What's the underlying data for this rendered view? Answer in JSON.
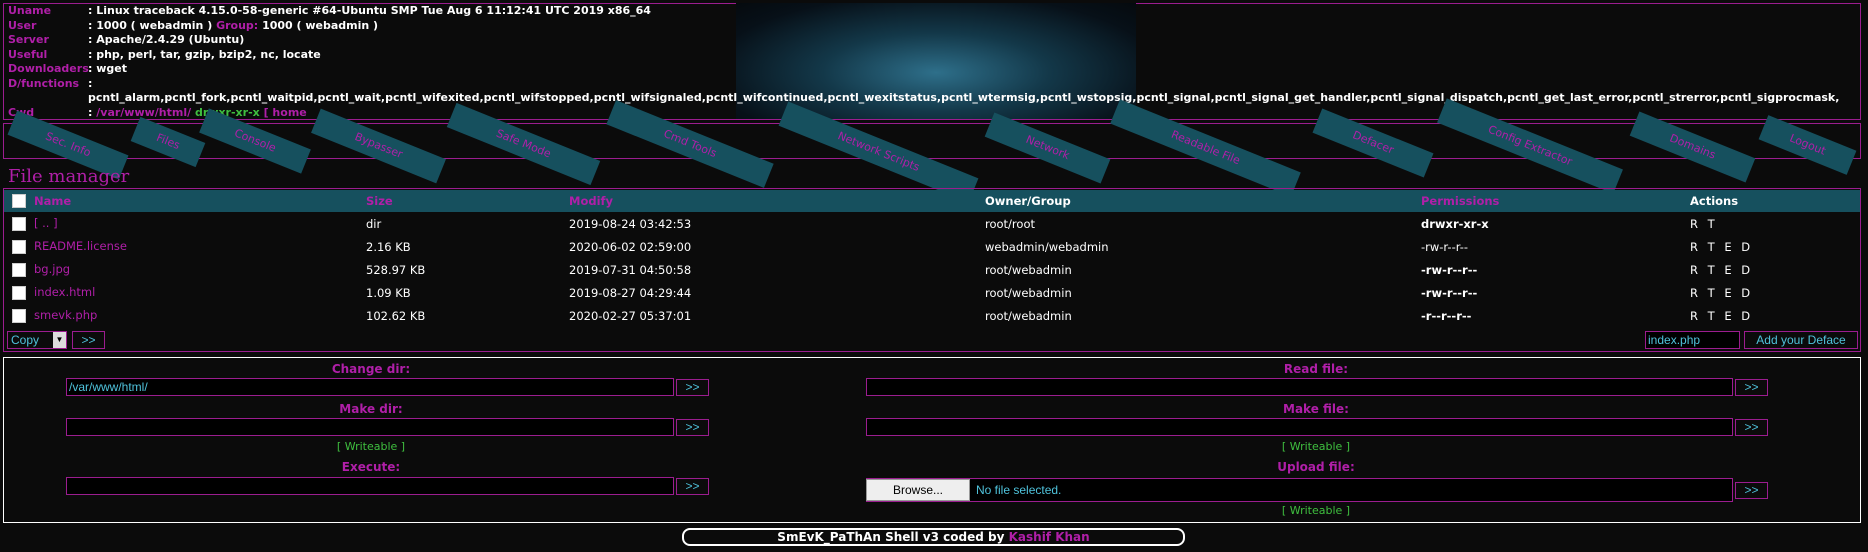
{
  "info": {
    "uname_label": "Uname",
    "uname_value": ": Linux traceback 4.15.0-58-generic #64-Ubuntu SMP Tue Aug 6 11:12:41 UTC 2019 x86_64",
    "user_label": "User",
    "user_value": ": 1000 ( webadmin )",
    "group_label": "Group:",
    "group_value": "1000 ( webadmin )",
    "server_label": "Server",
    "server_value": ": Apache/2.4.29 (Ubuntu)",
    "useful_label": "Useful",
    "useful_value": ": php, perl, tar, gzip, bzip2, nc, locate",
    "downloaders_label": "Downloaders",
    "downloaders_value": ": wget",
    "dfunctions_label": "D/functions",
    "dfunctions_value": ":",
    "functions_list": "pcntl_alarm,pcntl_fork,pcntl_waitpid,pcntl_wait,pcntl_wifexited,pcntl_wifstopped,pcntl_wifsignaled,pcntl_wifcontinued,pcntl_wexitstatus,pcntl_wtermsig,pcntl_wstopsig,pcntl_signal,pcntl_signal_get_handler,pcntl_signal_dispatch,pcntl_get_last_error,pcntl_strerror,pcntl_sigprocmask,",
    "cwd_label": "Cwd",
    "cwd_colon": ":",
    "cwd_path": "/var/www/html/",
    "cwd_perm": "drwxr-xr-x",
    "cwd_home": "[ home"
  },
  "menu": {
    "tabs": [
      "Sec. Info",
      "Files",
      "Console",
      "Bypasser",
      "Safe Mode",
      "Cmd Tools",
      "Network Scripts",
      "Network",
      "Readable File",
      "Defacer",
      "Config Extractor",
      "Domains",
      "Logout"
    ]
  },
  "file_manager": {
    "title": "File manager",
    "columns": [
      "Name",
      "Size",
      "Modify",
      "Owner/Group",
      "Permissions",
      "Actions"
    ],
    "rows": [
      {
        "name": "[ .. ]",
        "size": "dir",
        "modify": "2019-08-24 03:42:53",
        "owner": "root/root",
        "perms": "drwxr-xr-x",
        "actions": "R T"
      },
      {
        "name": "README.license",
        "size": "2.16 KB",
        "modify": "2020-06-02 02:59:00",
        "owner": "webadmin/webadmin",
        "perms": "-rw-r--r--",
        "actions": "R T E D"
      },
      {
        "name": "bg.jpg",
        "size": "528.97 KB",
        "modify": "2019-07-31 04:50:58",
        "owner": "root/webadmin",
        "perms": "-rw-r--r--",
        "actions": "R T E D"
      },
      {
        "name": "index.html",
        "size": "1.09 KB",
        "modify": "2019-08-27 04:29:44",
        "owner": "root/webadmin",
        "perms": "-rw-r--r--",
        "actions": "R T E D"
      },
      {
        "name": "smevk.php",
        "size": "102.62 KB",
        "modify": "2020-02-27 05:37:01",
        "owner": "root/webadmin",
        "perms": "-r--r--r--",
        "actions": "R T E D"
      }
    ],
    "copy_select": "Copy",
    "go_button": ">>",
    "deface_input": "index.php",
    "deface_button": "Add your Deface"
  },
  "tools": {
    "change_dir_label": "Change dir:",
    "change_dir_value": "/var/www/html/",
    "make_dir_label": "Make dir:",
    "make_dir_writeable": "[ Writeable ]",
    "execute_label": "Execute:",
    "read_file_label": "Read file:",
    "make_file_label": "Make file:",
    "make_file_writeable": "[ Writeable ]",
    "upload_label": "Upload file:",
    "browse_label": "Browse...",
    "no_file": "No file selected.",
    "upload_writeable": "[ Writeable ]",
    "go": ">>"
  },
  "footer": {
    "text": "SmEvK_PaThAn Shell v3 coded by",
    "author": "Kashif Khan"
  }
}
